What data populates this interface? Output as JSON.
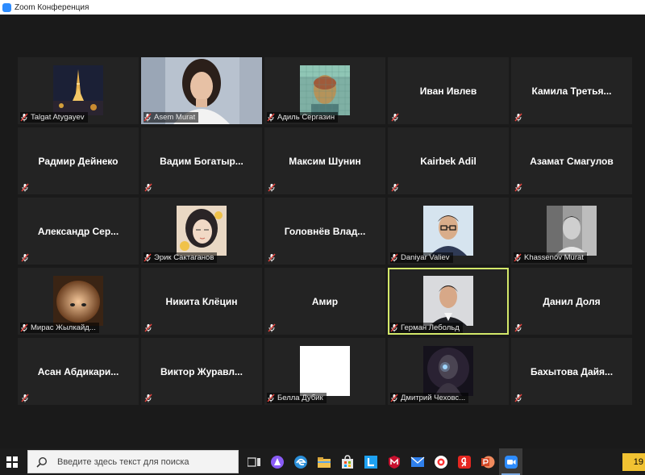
{
  "window": {
    "title": "Zoom Конференция"
  },
  "tiles": [
    {
      "kind": "video",
      "thumb": "eiffel-tower-night",
      "label": "Talgat Atygayev"
    },
    {
      "kind": "video-full",
      "thumb": "woman-camera",
      "label": "Asem Murat"
    },
    {
      "kind": "video",
      "thumb": "mosaic-portrait",
      "label": "Адиль Сергазин"
    },
    {
      "kind": "name",
      "name": "Иван Ивлев"
    },
    {
      "kind": "name",
      "name": "Камила  Третья..."
    },
    {
      "kind": "name",
      "name": "Радмир Дейнеко"
    },
    {
      "kind": "name",
      "name": "Вадим  Богатыр..."
    },
    {
      "kind": "name",
      "name": "Максим Шунин"
    },
    {
      "kind": "name",
      "name": "Kairbek Adil"
    },
    {
      "kind": "name",
      "name": "Азамат Смагулов"
    },
    {
      "kind": "name",
      "name": "Александр  Сер..."
    },
    {
      "kind": "video",
      "thumb": "girl-illustration",
      "label": "Эрик Сактаганов"
    },
    {
      "kind": "name",
      "name": "Головнёв  Влад..."
    },
    {
      "kind": "video",
      "thumb": "young-man-glasses",
      "label": "Daniyar Valiev"
    },
    {
      "kind": "video",
      "thumb": "bw-man-photo",
      "label": "Khassenov Murat"
    },
    {
      "kind": "video",
      "thumb": "blurry-face",
      "label": "Мирас Жылкайд..."
    },
    {
      "kind": "name",
      "name": "Никита Клёцин"
    },
    {
      "kind": "name",
      "name": "Амир"
    },
    {
      "kind": "video",
      "thumb": "man-portrait",
      "label": "Герман Лебольд",
      "active": true
    },
    {
      "kind": "name",
      "name": "Данил Доля"
    },
    {
      "kind": "name",
      "name": "Асан  Абдикари..."
    },
    {
      "kind": "name",
      "name": "Виктор  Журавл..."
    },
    {
      "kind": "video",
      "thumb": "white-blank",
      "label": "Белла Дубик"
    },
    {
      "kind": "video",
      "thumb": "sci-fi-soldier",
      "label": "Дмитрий Чеховс..."
    },
    {
      "kind": "name",
      "name": "Бахытова  Дайя..."
    }
  ],
  "taskbar": {
    "search_placeholder": "Введите здесь текст для поиска",
    "apps": [
      {
        "icon": "task-view-icon",
        "color": "#d9d9d9"
      },
      {
        "icon": "alice-assistant-icon",
        "color": "#8a5cf6"
      },
      {
        "icon": "edge-browser-icon",
        "color": "#2b8fd9"
      },
      {
        "icon": "file-explorer-icon",
        "color": "#f2c14e"
      },
      {
        "icon": "store-icon",
        "color": "#e6e6e6"
      },
      {
        "icon": "app-l-icon",
        "color": "#1da1f2"
      },
      {
        "icon": "mcafee-icon",
        "color": "#c8102e"
      },
      {
        "icon": "mail-icon",
        "color": "#2f80ed"
      },
      {
        "icon": "yandex-browser-icon",
        "color": "#ffffff"
      },
      {
        "icon": "yandex-icon",
        "color": "#e52620"
      },
      {
        "icon": "powerpoint-icon",
        "color": "#d24726"
      },
      {
        "icon": "zoom-icon",
        "color": "#2d8cff",
        "active": true
      }
    ],
    "clock": "19"
  },
  "colors": {
    "active_border": "#d3e86a",
    "muted_mic": "#e0443e",
    "accent": "#2d8cff"
  }
}
